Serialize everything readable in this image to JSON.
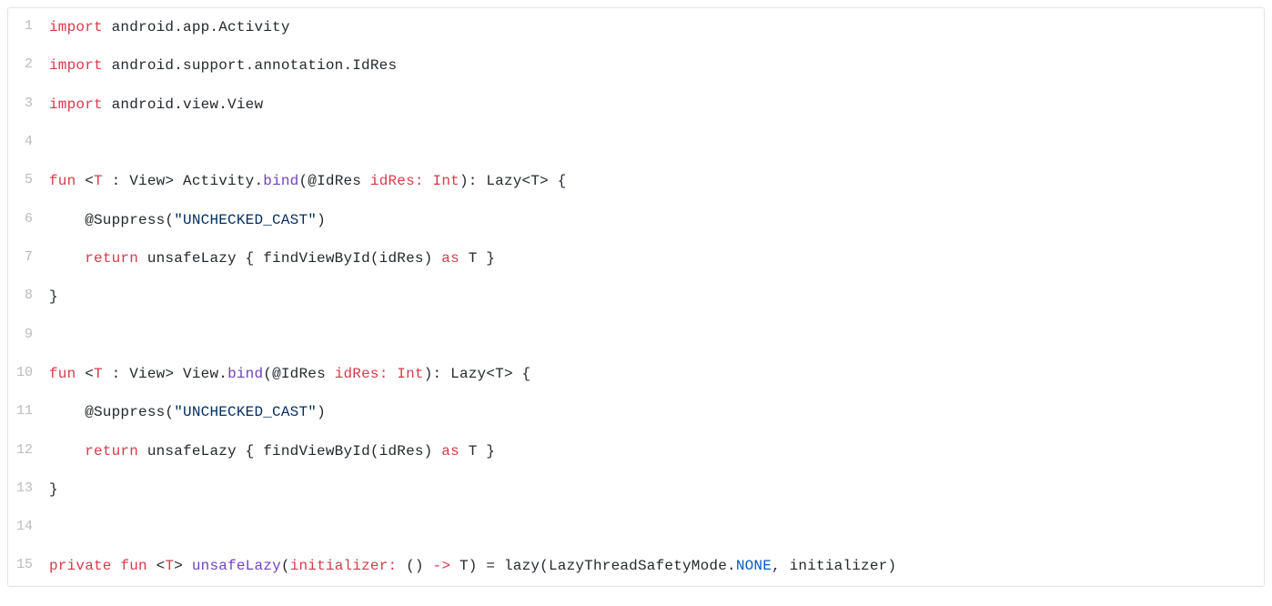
{
  "code": {
    "lines": [
      {
        "num": "1",
        "tokens": [
          {
            "cls": "tok-keyword",
            "text": "import"
          },
          {
            "cls": "tok-plain",
            "text": " android.app.Activity"
          }
        ]
      },
      {
        "num": "2",
        "tokens": [
          {
            "cls": "tok-keyword",
            "text": "import"
          },
          {
            "cls": "tok-plain",
            "text": " android.support.annotation.IdRes"
          }
        ]
      },
      {
        "num": "3",
        "tokens": [
          {
            "cls": "tok-keyword",
            "text": "import"
          },
          {
            "cls": "tok-plain",
            "text": " android.view.View"
          }
        ]
      },
      {
        "num": "4",
        "tokens": []
      },
      {
        "num": "5",
        "tokens": [
          {
            "cls": "tok-keyword",
            "text": "fun"
          },
          {
            "cls": "tok-plain",
            "text": " <"
          },
          {
            "cls": "tok-keyword",
            "text": "T"
          },
          {
            "cls": "tok-plain",
            "text": " : View> Activity."
          },
          {
            "cls": "tok-function",
            "text": "bind"
          },
          {
            "cls": "tok-plain",
            "text": "(@IdRes "
          },
          {
            "cls": "tok-keyword",
            "text": "idRes:"
          },
          {
            "cls": "tok-plain",
            "text": " "
          },
          {
            "cls": "tok-keyword",
            "text": "Int"
          },
          {
            "cls": "tok-plain",
            "text": "): Lazy<T> {"
          }
        ]
      },
      {
        "num": "6",
        "tokens": [
          {
            "cls": "tok-plain",
            "text": "    @Suppress("
          },
          {
            "cls": "tok-string",
            "text": "\"UNCHECKED_CAST\""
          },
          {
            "cls": "tok-plain",
            "text": ")"
          }
        ]
      },
      {
        "num": "7",
        "tokens": [
          {
            "cls": "tok-plain",
            "text": "    "
          },
          {
            "cls": "tok-keyword",
            "text": "return"
          },
          {
            "cls": "tok-plain",
            "text": " unsafeLazy { findViewById(idRes) "
          },
          {
            "cls": "tok-keyword",
            "text": "as"
          },
          {
            "cls": "tok-plain",
            "text": " T }"
          }
        ]
      },
      {
        "num": "8",
        "tokens": [
          {
            "cls": "tok-plain",
            "text": "}"
          }
        ]
      },
      {
        "num": "9",
        "tokens": []
      },
      {
        "num": "10",
        "tokens": [
          {
            "cls": "tok-keyword",
            "text": "fun"
          },
          {
            "cls": "tok-plain",
            "text": " <"
          },
          {
            "cls": "tok-keyword",
            "text": "T"
          },
          {
            "cls": "tok-plain",
            "text": " : View> View."
          },
          {
            "cls": "tok-function",
            "text": "bind"
          },
          {
            "cls": "tok-plain",
            "text": "(@IdRes "
          },
          {
            "cls": "tok-keyword",
            "text": "idRes:"
          },
          {
            "cls": "tok-plain",
            "text": " "
          },
          {
            "cls": "tok-keyword",
            "text": "Int"
          },
          {
            "cls": "tok-plain",
            "text": "): Lazy<T> {"
          }
        ]
      },
      {
        "num": "11",
        "tokens": [
          {
            "cls": "tok-plain",
            "text": "    @Suppress("
          },
          {
            "cls": "tok-string",
            "text": "\"UNCHECKED_CAST\""
          },
          {
            "cls": "tok-plain",
            "text": ")"
          }
        ]
      },
      {
        "num": "12",
        "tokens": [
          {
            "cls": "tok-plain",
            "text": "    "
          },
          {
            "cls": "tok-keyword",
            "text": "return"
          },
          {
            "cls": "tok-plain",
            "text": " unsafeLazy { findViewById(idRes) "
          },
          {
            "cls": "tok-keyword",
            "text": "as"
          },
          {
            "cls": "tok-plain",
            "text": " T }"
          }
        ]
      },
      {
        "num": "13",
        "tokens": [
          {
            "cls": "tok-plain",
            "text": "}"
          }
        ]
      },
      {
        "num": "14",
        "tokens": []
      },
      {
        "num": "15",
        "tokens": [
          {
            "cls": "tok-keyword",
            "text": "private"
          },
          {
            "cls": "tok-plain",
            "text": " "
          },
          {
            "cls": "tok-keyword",
            "text": "fun"
          },
          {
            "cls": "tok-plain",
            "text": " <"
          },
          {
            "cls": "tok-keyword",
            "text": "T"
          },
          {
            "cls": "tok-plain",
            "text": "> "
          },
          {
            "cls": "tok-function",
            "text": "unsafeLazy"
          },
          {
            "cls": "tok-plain",
            "text": "("
          },
          {
            "cls": "tok-keyword",
            "text": "initializer:"
          },
          {
            "cls": "tok-plain",
            "text": " () "
          },
          {
            "cls": "tok-keyword",
            "text": "->"
          },
          {
            "cls": "tok-plain",
            "text": " T) = lazy(LazyThreadSafetyMode."
          },
          {
            "cls": "tok-type",
            "text": "NONE"
          },
          {
            "cls": "tok-plain",
            "text": ", initializer)"
          }
        ]
      }
    ]
  }
}
